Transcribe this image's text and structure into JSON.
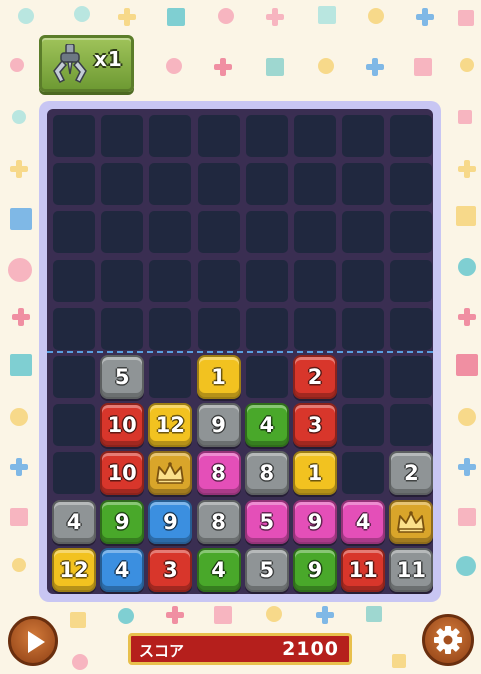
{
  "claw_item": {
    "count_label": "x1",
    "icon": "claw-icon"
  },
  "score": {
    "label": "スコア",
    "value": "2100"
  },
  "buttons": {
    "play_icon": "play-icon",
    "settings_icon": "gear-icon"
  },
  "colors": {
    "red": "#d8362b",
    "yellow": "#f2c220",
    "gray": "#8f9496",
    "green": "#49a82a",
    "blue": "#3b8fe0",
    "pink": "#e44fb8",
    "gold": "#d9a52a"
  },
  "board": {
    "columns": 8,
    "rows": 10,
    "tiles": [
      {
        "row": 5,
        "col": 1,
        "label": "5",
        "color": "gray"
      },
      {
        "row": 5,
        "col": 3,
        "label": "1",
        "color": "yellow"
      },
      {
        "row": 5,
        "col": 5,
        "label": "2",
        "color": "red"
      },
      {
        "row": 6,
        "col": 1,
        "label": "10",
        "color": "red"
      },
      {
        "row": 6,
        "col": 2,
        "label": "12",
        "color": "yellow"
      },
      {
        "row": 6,
        "col": 3,
        "label": "9",
        "color": "gray"
      },
      {
        "row": 6,
        "col": 4,
        "label": "4",
        "color": "green"
      },
      {
        "row": 6,
        "col": 5,
        "label": "3",
        "color": "red"
      },
      {
        "row": 7,
        "col": 1,
        "label": "10",
        "color": "red"
      },
      {
        "row": 7,
        "col": 2,
        "label": "",
        "color": "gold",
        "crown": true
      },
      {
        "row": 7,
        "col": 3,
        "label": "8",
        "color": "pink"
      },
      {
        "row": 7,
        "col": 4,
        "label": "8",
        "color": "gray"
      },
      {
        "row": 7,
        "col": 5,
        "label": "1",
        "color": "yellow"
      },
      {
        "row": 7,
        "col": 7,
        "label": "2",
        "color": "gray"
      },
      {
        "row": 8,
        "col": 0,
        "label": "4",
        "color": "gray"
      },
      {
        "row": 8,
        "col": 1,
        "label": "9",
        "color": "green"
      },
      {
        "row": 8,
        "col": 2,
        "label": "9",
        "color": "blue"
      },
      {
        "row": 8,
        "col": 3,
        "label": "8",
        "color": "gray"
      },
      {
        "row": 8,
        "col": 4,
        "label": "5",
        "color": "pink"
      },
      {
        "row": 8,
        "col": 5,
        "label": "9",
        "color": "pink"
      },
      {
        "row": 8,
        "col": 6,
        "label": "4",
        "color": "pink"
      },
      {
        "row": 8,
        "col": 7,
        "label": "",
        "color": "gold",
        "crown": true
      },
      {
        "row": 9,
        "col": 0,
        "label": "12",
        "color": "yellow"
      },
      {
        "row": 9,
        "col": 1,
        "label": "4",
        "color": "blue"
      },
      {
        "row": 9,
        "col": 2,
        "label": "3",
        "color": "red"
      },
      {
        "row": 9,
        "col": 3,
        "label": "4",
        "color": "green"
      },
      {
        "row": 9,
        "col": 4,
        "label": "5",
        "color": "gray"
      },
      {
        "row": 9,
        "col": 5,
        "label": "9",
        "color": "green"
      },
      {
        "row": 9,
        "col": 6,
        "label": "11",
        "color": "red"
      },
      {
        "row": 9,
        "col": 7,
        "label": "11",
        "color": "gray"
      }
    ]
  }
}
